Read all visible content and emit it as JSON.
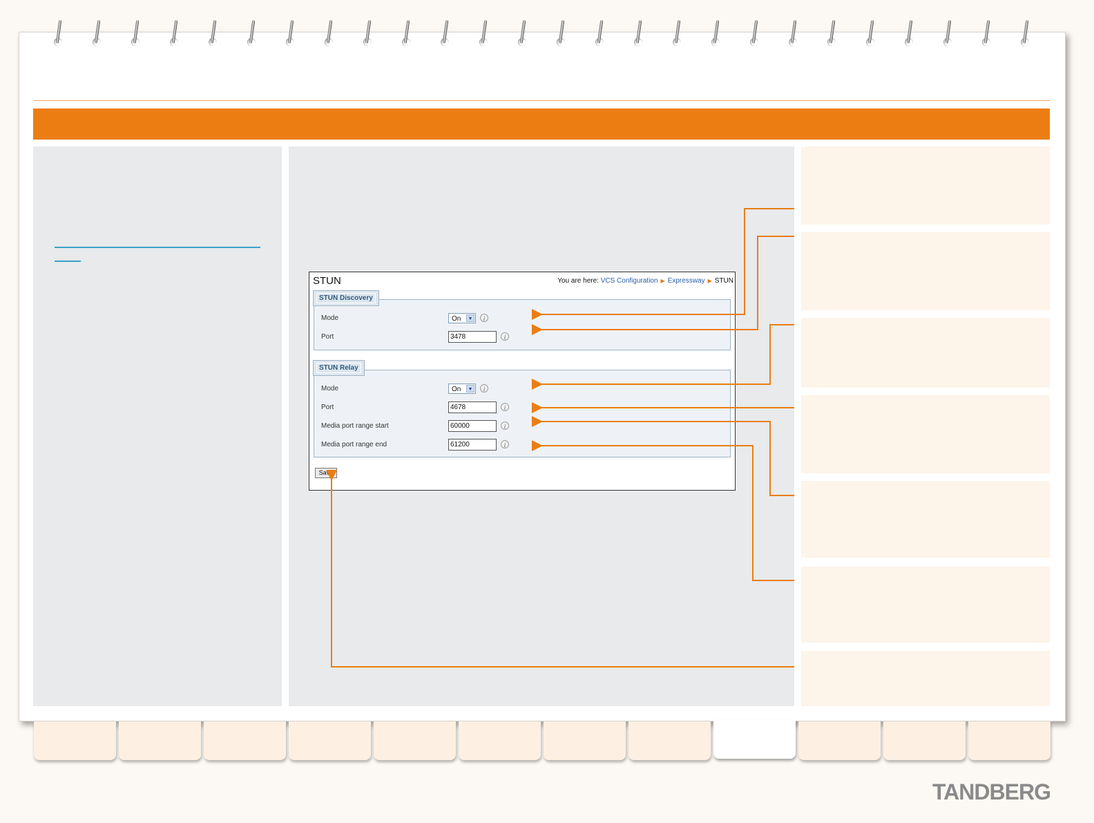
{
  "brand": {
    "logo_text": "TANDBERG",
    "accent": "#eb7d12",
    "link_color": "#3aa0c8"
  },
  "screen": {
    "title": "STUN",
    "breadcrumb": {
      "prefix": "You are here:",
      "items": [
        "VCS Configuration",
        "Expressway",
        "STUN"
      ]
    },
    "stun_discovery": {
      "legend": "STUN Discovery",
      "mode_label": "Mode",
      "mode_value": "On",
      "port_label": "Port",
      "port_value": "3478"
    },
    "stun_relay": {
      "legend": "STUN Relay",
      "mode_label": "Mode",
      "mode_value": "On",
      "port_label": "Port",
      "port_value": "4678",
      "range_start_label": "Media port range start",
      "range_start_value": "60000",
      "range_end_label": "Media port range end",
      "range_end_value": "61200"
    },
    "save_label": "Save",
    "info_glyph": "i",
    "dropdown_glyph": "▼"
  },
  "tabs": {
    "count": 12,
    "active_index": 8
  }
}
